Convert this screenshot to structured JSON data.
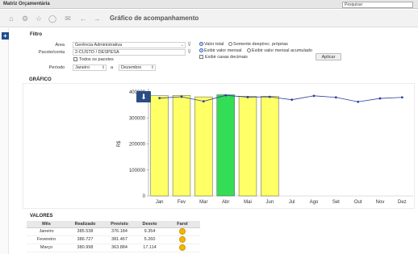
{
  "app": {
    "title": "Matriz Orçamentária",
    "search_placeholder": "Pesquisar"
  },
  "nav": {
    "page_title": "Gráfico de acompanhamento"
  },
  "filter": {
    "section_title": "Filtro",
    "area_label": "Área",
    "area_value": "Gerência Administrativa",
    "account_label": "Pacote/conta",
    "account_value": "2-CUSTO / DESPESA",
    "all_packages_label": "Todos os pacotes",
    "period_label": "Período",
    "period_from": "Janeiro",
    "period_sep": "a",
    "period_to": "Dezembro",
    "radio_total": "Valor total",
    "radio_own": "Somente deep/rec. próprias",
    "radio_monthly": "Exibir valor mensal",
    "radio_accum": "Exibir valor mensal acumulado",
    "decimals_label": "Exibir casas decimais",
    "apply_label": "Aplicar"
  },
  "chart_section": {
    "title": "GRÁFICO"
  },
  "chart_data": {
    "type": "bar",
    "categories": [
      "Jan",
      "Fev",
      "Mar",
      "Abr",
      "Mai",
      "Jun",
      "Jul",
      "Ago",
      "Set",
      "Out",
      "Nov",
      "Dez"
    ],
    "series": [
      {
        "values": [
          385538,
          386727,
          380998,
          389000,
          383000,
          383500,
          null,
          null,
          null,
          null,
          null,
          null
        ],
        "colors": [
          "#ffff66",
          "#ffff66",
          "#ffff66",
          "#33dd55",
          "#ffff66",
          "#ffff66"
        ]
      },
      {
        "values": [
          376184,
          381467,
          363884,
          387000,
          380000,
          381000,
          370000,
          385000,
          379000,
          362000,
          375000,
          379000
        ]
      }
    ],
    "ylabel": "R$",
    "ylim": [
      0,
      400000
    ],
    "yticks": [
      "0",
      "100000",
      "200000",
      "300000",
      "400000"
    ],
    "grid": false,
    "bar_color": "#ffff66",
    "highlight_color": "#33dd55",
    "line_color": "#2b3fa0"
  },
  "values": {
    "section_title": "VALORES",
    "headers": [
      "Mês",
      "Realizado",
      "Previsto",
      "Desvio",
      "Farol"
    ],
    "rows": [
      [
        "Janeiro",
        "385.538",
        "376.184",
        "9.354"
      ],
      [
        "Fevereiro",
        "386.727",
        "381.467",
        "5.260"
      ],
      [
        "Março",
        "380.998",
        "363.884",
        "17.114"
      ]
    ],
    "farol_color": "#f2b705"
  }
}
